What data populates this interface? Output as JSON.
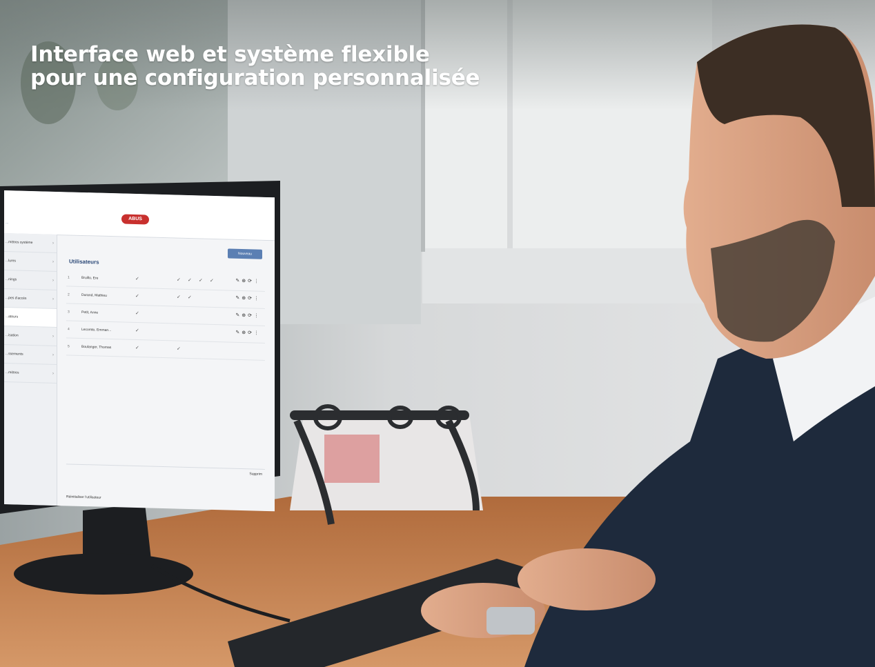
{
  "headline": {
    "line1": "Interface web et système flexible",
    "line2": "pour une configuration personnalisée"
  },
  "screen": {
    "window_title": "...",
    "logo": "ABUS",
    "new_button": "Nouveau",
    "heading": "Utilisateurs",
    "sidebar": [
      {
        "label": "...mètres système",
        "chevron": "›"
      },
      {
        "label": "...lures",
        "chevron": "›"
      },
      {
        "label": "...nings",
        "chevron": "›"
      },
      {
        "label": "...pes d'accès",
        "chevron": "›"
      },
      {
        "label": "...ateurs",
        "chevron": ""
      },
      {
        "label": "...isation",
        "chevron": "›"
      },
      {
        "label": "...ssements",
        "chevron": "›"
      },
      {
        "label": "...mètres",
        "chevron": "›"
      }
    ],
    "rows": [
      {
        "num": "1",
        "name": "Bruillo, Ere"
      },
      {
        "num": "2",
        "name": "Durand, Mathieu"
      },
      {
        "num": "3",
        "name": "Petit, Anne"
      },
      {
        "num": "4",
        "name": "Lecomte, Emman..."
      },
      {
        "num": "5",
        "name": "Boulanger, Thomas"
      }
    ],
    "delete_label": "Supprim",
    "footer_label": "Réinitialiser l'utilisateur"
  },
  "colors": {
    "accent": "#2d4a78",
    "logo": "#c8302e",
    "desk": "#c07a45",
    "jacket": "#1e2a3c"
  }
}
